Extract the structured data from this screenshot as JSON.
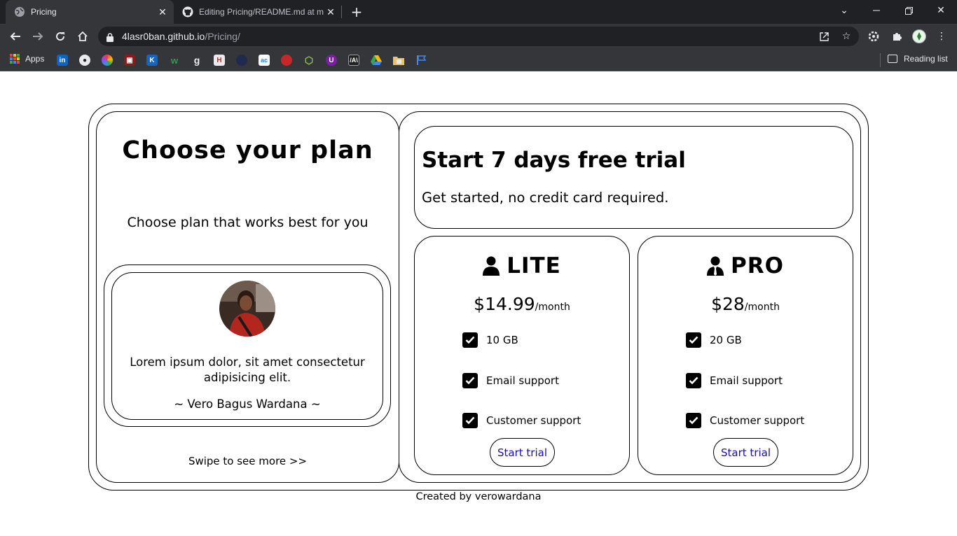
{
  "browser": {
    "tabs": [
      {
        "title": "Pricing",
        "active": true
      },
      {
        "title": "Editing Pricing/README.md at m",
        "active": false
      }
    ],
    "url_host": "4lasr0ban.github.io",
    "url_path": "/Pricing/",
    "bookmarks": {
      "apps_label": "Apps",
      "reading_list_label": "Reading list",
      "icons": [
        "linkedin-icon",
        "github-icon",
        "spiral-icon",
        "red-square-icon",
        "k-icon",
        "w-icon",
        "g-icon",
        "h-icon",
        "dark-circle-icon",
        "ac-icon",
        "red-blob-icon",
        "green-box-icon",
        "purple-u-icon",
        "angular-icon",
        "drive-icon",
        "folder-icon",
        "flag-icon"
      ]
    }
  },
  "pricing": {
    "heading": "Choose your plan",
    "subheading": "Choose plan that works best for you",
    "testimonial": {
      "quote": "Lorem ipsum dolor, sit amet consectetur adipisicing elit.",
      "author": "~ Vero Bagus Wardana ~"
    },
    "swipe_hint": "Swipe to see more >>",
    "trial": {
      "title": "Start 7 days free trial",
      "subtitle": "Get started, no credit card required."
    },
    "plans": [
      {
        "name": "LITE",
        "price": "$14.99",
        "period": "/month",
        "features": [
          "10 GB",
          "Email support",
          "Customer support"
        ],
        "button": "Start trial"
      },
      {
        "name": "PRO",
        "price": "$28",
        "period": "/month",
        "features": [
          "20 GB",
          "Email support",
          "Customer support"
        ],
        "button": "Start trial"
      }
    ],
    "footer": "Created by verowardana"
  }
}
